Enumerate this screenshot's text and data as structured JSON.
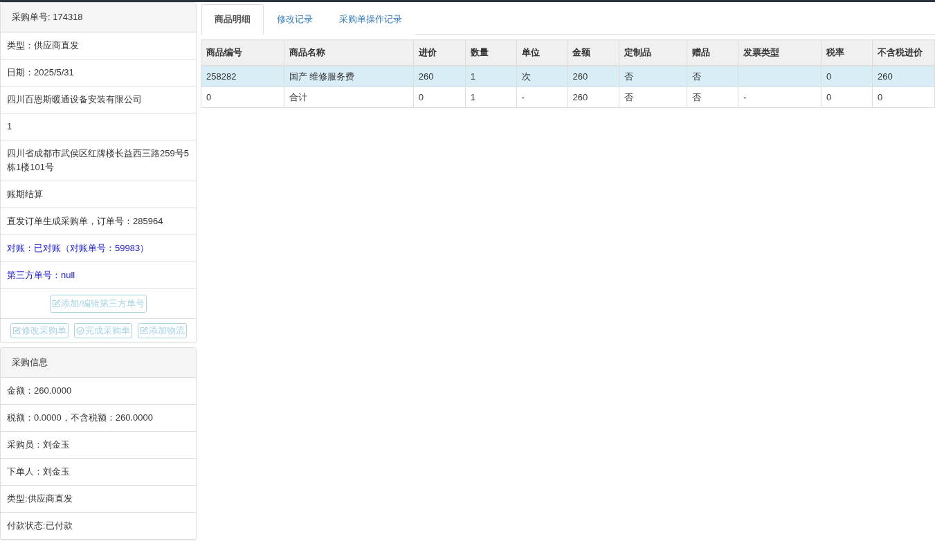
{
  "order_panel": {
    "title": "采购单号: 174318",
    "rows": [
      {
        "text": "类型：供应商直发",
        "kind": "plain"
      },
      {
        "text": "日期：2025/5/31",
        "kind": "plain"
      },
      {
        "text": "四川百恩斯暖通设备安装有限公司",
        "kind": "plain"
      },
      {
        "text": "1",
        "kind": "plain"
      },
      {
        "text": "四川省成都市武侯区红牌楼长益西三路259号5栋1楼101号",
        "kind": "plain"
      },
      {
        "text": "账期结算",
        "kind": "plain"
      },
      {
        "text": "直发订单生成采购单，订单号：285964",
        "kind": "plain"
      },
      {
        "text": "对账：已对账（对账单号：59983）",
        "kind": "highlight"
      },
      {
        "text": "第三方单号：null",
        "kind": "highlight"
      }
    ],
    "third_party_button": "添加/编辑第三方单号",
    "action_buttons": [
      {
        "label": "修改采购单",
        "kind": "edit"
      },
      {
        "label": "完成采购单",
        "kind": "complete"
      },
      {
        "label": "添加物流",
        "kind": "edit"
      }
    ]
  },
  "purchase_panel": {
    "title": "采购信息",
    "rows": [
      "金额：260.0000",
      "税额：0.0000，不含税额：260.0000",
      "采购员：刘金玉",
      "下单人：刘金玉",
      "类型:供应商直发",
      "付款状态:已付款"
    ]
  },
  "tabs": [
    {
      "label": "商品明细",
      "selected": true
    },
    {
      "label": "修改记录",
      "selected": false
    },
    {
      "label": "采购单操作记录",
      "selected": false
    }
  ],
  "table": {
    "columns": [
      "商品编号",
      "商品名称",
      "进价",
      "数量",
      "单位",
      "金额",
      "定制品",
      "赠品",
      "发票类型",
      "税率",
      "不含税进价"
    ],
    "rows": [
      {
        "selected": true,
        "cells": [
          "258282",
          "国产 维修服务费",
          "260",
          "1",
          "次",
          "260",
          "否",
          "否",
          "",
          "0",
          "260"
        ]
      },
      {
        "selected": false,
        "cells": [
          "0",
          "合计",
          "0",
          "1",
          "-",
          "260",
          "否",
          "否",
          "-",
          "0",
          "0"
        ]
      }
    ]
  }
}
